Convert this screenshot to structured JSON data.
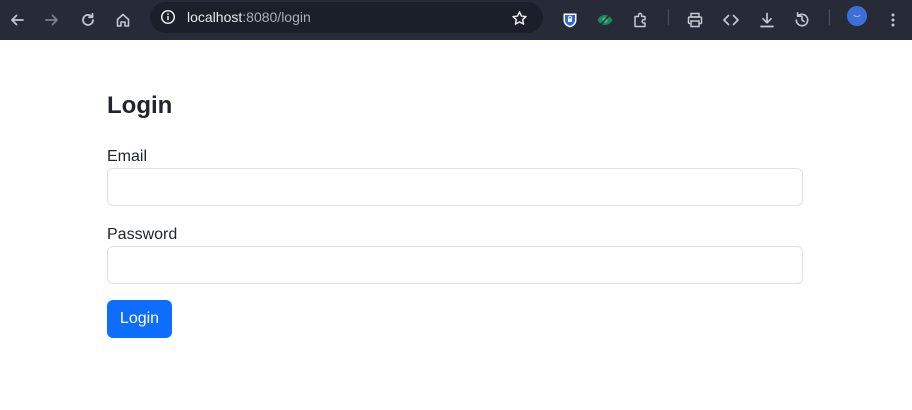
{
  "browser": {
    "url_host": "localhost",
    "url_rest": ":8080/login",
    "colors": {
      "toolbar_bg": "#272b38",
      "omnibox_bg": "#1b1f29",
      "icon": "#c4c7cf",
      "avatar": "#3e6fd8"
    },
    "icons": [
      "back-arrow-icon",
      "forward-arrow-icon",
      "reload-icon",
      "home-icon",
      "site-info-icon",
      "bookmark-star-icon",
      "shield-extension-icon",
      "eye-extension-icon",
      "puzzle-extensions-icon",
      "print-icon",
      "code-icon",
      "download-icon",
      "history-icon",
      "profile-avatar",
      "kebab-menu-icon"
    ]
  },
  "page": {
    "title": "Login",
    "email_label": "Email",
    "email_value": "",
    "password_label": "Password",
    "password_value": "",
    "submit_label": "Login",
    "colors": {
      "primary": "#0d6efd",
      "text": "#212529",
      "border": "#dee2e6"
    }
  }
}
